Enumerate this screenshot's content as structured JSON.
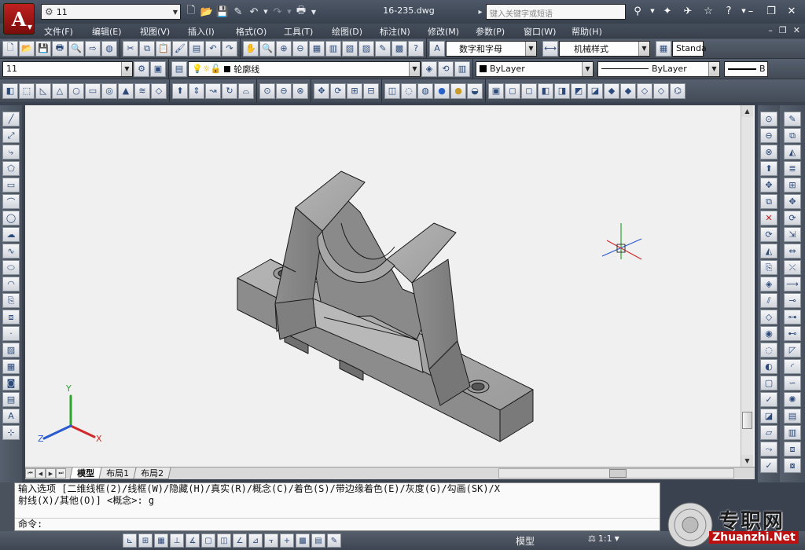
{
  "titlebar": {
    "app_letter": "A",
    "workspace": "11",
    "document_title": "16-235.dwg",
    "search_placeholder": "键入关键字或短语"
  },
  "menu": {
    "items": [
      "文件(F)",
      "编辑(E)",
      "视图(V)",
      "插入(I)",
      "格式(O)",
      "工具(T)",
      "绘图(D)",
      "标注(N)",
      "修改(M)",
      "参数(P)",
      "窗口(W)",
      "帮助(H)"
    ]
  },
  "toolbar_row1": {
    "text_style": "数字和字母",
    "dim_style": "机械样式",
    "table_style": "Standa"
  },
  "toolbar_row2": {
    "workspace_combo": "11",
    "layer": "轮廓线",
    "color": "ByLayer",
    "linetype": "ByLayer",
    "lineweight": "B"
  },
  "layout_tabs": [
    "模型",
    "布局1",
    "布局2"
  ],
  "command": {
    "line1": "输入选项 [二维线框(2)/线框(W)/隐藏(H)/真实(R)/概念(C)/着色(S)/带边缘着色(E)/灰度(G)/勾画(SK)/X",
    "line2": "射线(X)/其他(O)] <概念>: g",
    "prompt": "命令:"
  },
  "status": {
    "model_label": "模型",
    "scale": "1:1"
  },
  "ucs": {
    "x": "X",
    "y": "Y",
    "z": "Z"
  },
  "watermark": {
    "text": "专职网",
    "url": "Zhuanzhi.Net"
  },
  "colors": {
    "title_bg": "#3e4653",
    "canvas_bg": "#f0f0f0",
    "part_fill": "#9a9a9a",
    "accent_red": "#c02020"
  }
}
